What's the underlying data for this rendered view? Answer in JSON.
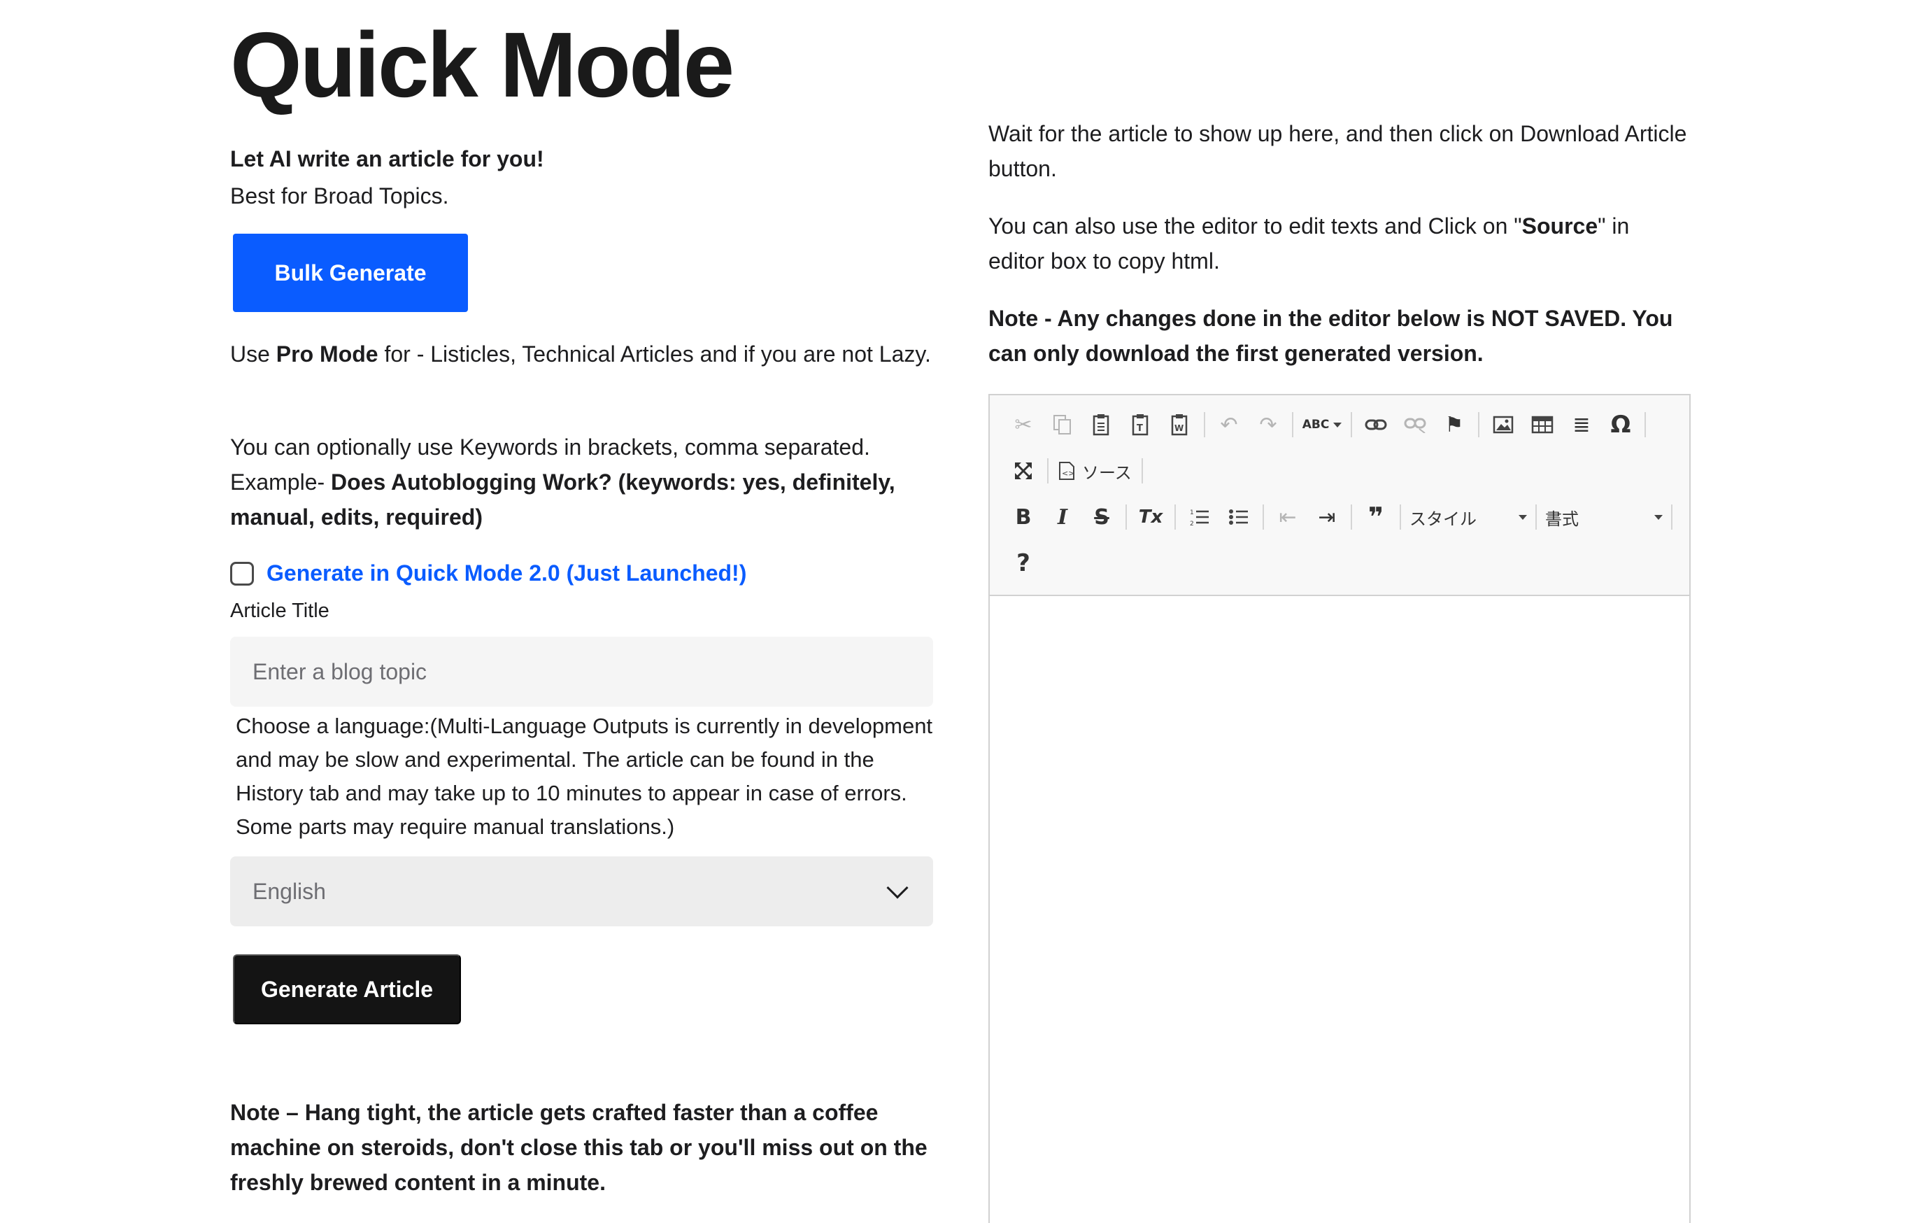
{
  "page": {
    "title": "Quick Mode",
    "intro_bold": "Let AI write an article for you!",
    "intro_sub": "Best for Broad Topics.",
    "bulk_button": "Bulk Generate",
    "pro_prefix": "Use ",
    "pro_bold": "Pro Mode",
    "pro_suffix": " for - Listicles, Technical Articles and if you are not Lazy.",
    "keywords_prefix": "You can optionally use Keywords in brackets, comma separated. Example- ",
    "keywords_bold": "Does Autoblogging Work? (keywords: yes, definitely, manual, edits, required)",
    "quick2_label": "Generate in Quick Mode 2.0 (Just Launched!)",
    "article_title_label": "Article Title",
    "article_title_placeholder": "Enter a blog topic",
    "language_description": "Choose a language:(Multi-Language Outputs is currently in development and may be slow and experimental. The article can be found in the History tab and may take up to 10 minutes to appear in case of errors. Some parts may require manual translations.)",
    "language_selected": "English",
    "generate_button": "Generate Article",
    "note_left": "Note – Hang tight, the article gets crafted faster than a coffee machine on steroids, don't close this tab or you'll miss out on the freshly brewed content in a minute."
  },
  "right": {
    "wait_text": "Wait for the article to show up here, and then click on Download Article button.",
    "editor_prefix": "You can also use the editor to edit texts and Click on \"",
    "editor_bold": "Source",
    "editor_suffix": "\" in editor box to copy html.",
    "note": "Note - Any changes done in the editor below is NOT SAVED. You can only download the first generated version."
  },
  "editor": {
    "source_label": "ソース",
    "style_label": "スタイル",
    "format_label": "書式",
    "icons": {
      "cut": "✂",
      "copy": "⧉",
      "paste": "📋",
      "undo": "↶",
      "redo": "↷",
      "spell": "ABC",
      "link": "🔗",
      "anchor": "⚑",
      "image": "🖼",
      "table": "▦",
      "hr": "≣",
      "special_char": "Ω",
      "maximize": "⤢",
      "bold": "B",
      "italic": "I",
      "strike": "S",
      "remove_format": "Tx",
      "numbered": "≔",
      "bulleted": "☰",
      "outdent": "⇤",
      "indent": "⇥",
      "quote": "❞",
      "help": "?"
    }
  }
}
